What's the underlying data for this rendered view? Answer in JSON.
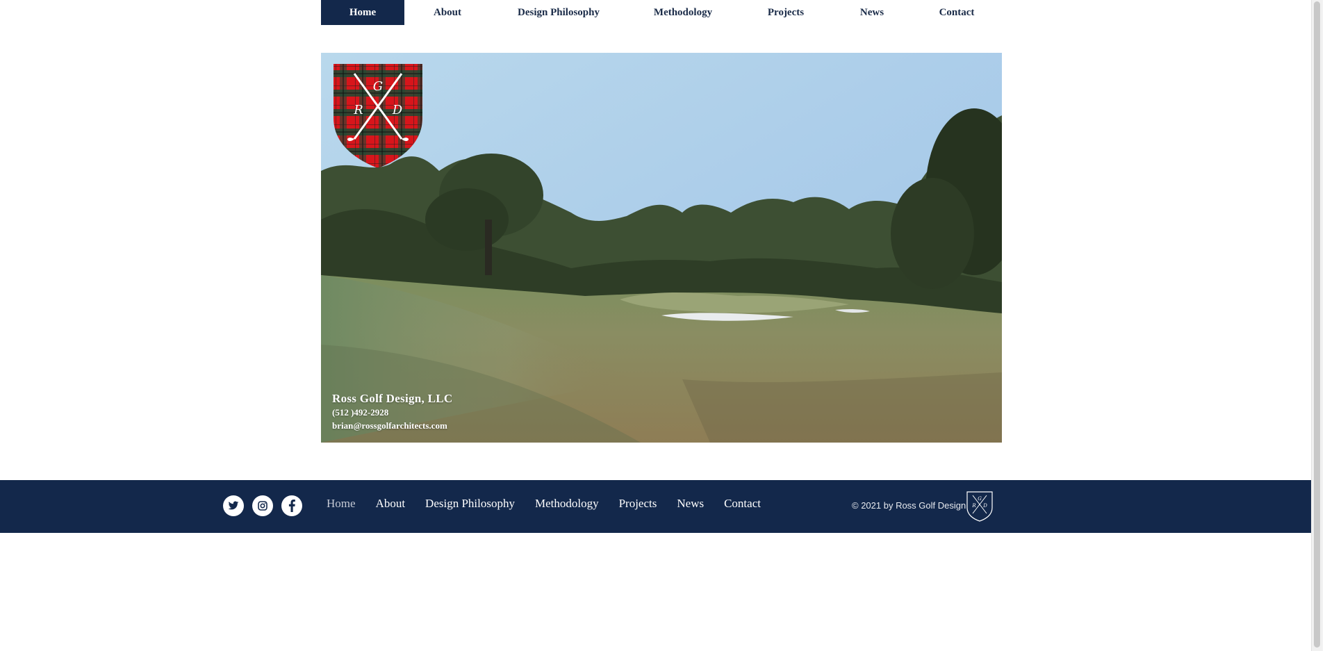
{
  "nav": {
    "items": [
      {
        "label": "Home",
        "active": true
      },
      {
        "label": "About",
        "active": false
      },
      {
        "label": "Design Philosophy",
        "active": false
      },
      {
        "label": "Methodology",
        "active": false
      },
      {
        "label": "Projects",
        "active": false
      },
      {
        "label": "News",
        "active": false
      },
      {
        "label": "Contact",
        "active": false
      }
    ]
  },
  "hero": {
    "crest_letters": {
      "top": "G",
      "left": "R",
      "right": "D"
    },
    "company": "Ross Golf Design, LLC",
    "phone": "(512 )492-2928",
    "email": "brian@rossgolfarchitects.com"
  },
  "footer": {
    "social": [
      "twitter-icon",
      "instagram-icon",
      "facebook-icon"
    ],
    "items": [
      {
        "label": "Home",
        "active": true
      },
      {
        "label": "About",
        "active": false
      },
      {
        "label": "Design Philosophy",
        "active": false
      },
      {
        "label": "Methodology",
        "active": false
      },
      {
        "label": "Projects",
        "active": false
      },
      {
        "label": "News",
        "active": false
      },
      {
        "label": "Contact",
        "active": false
      }
    ],
    "copyright": "© 2021 by Ross Golf Design"
  },
  "colors": {
    "navy": "#13284b",
    "tartan_red": "#d8151b",
    "tartan_green": "#1f4a33"
  }
}
